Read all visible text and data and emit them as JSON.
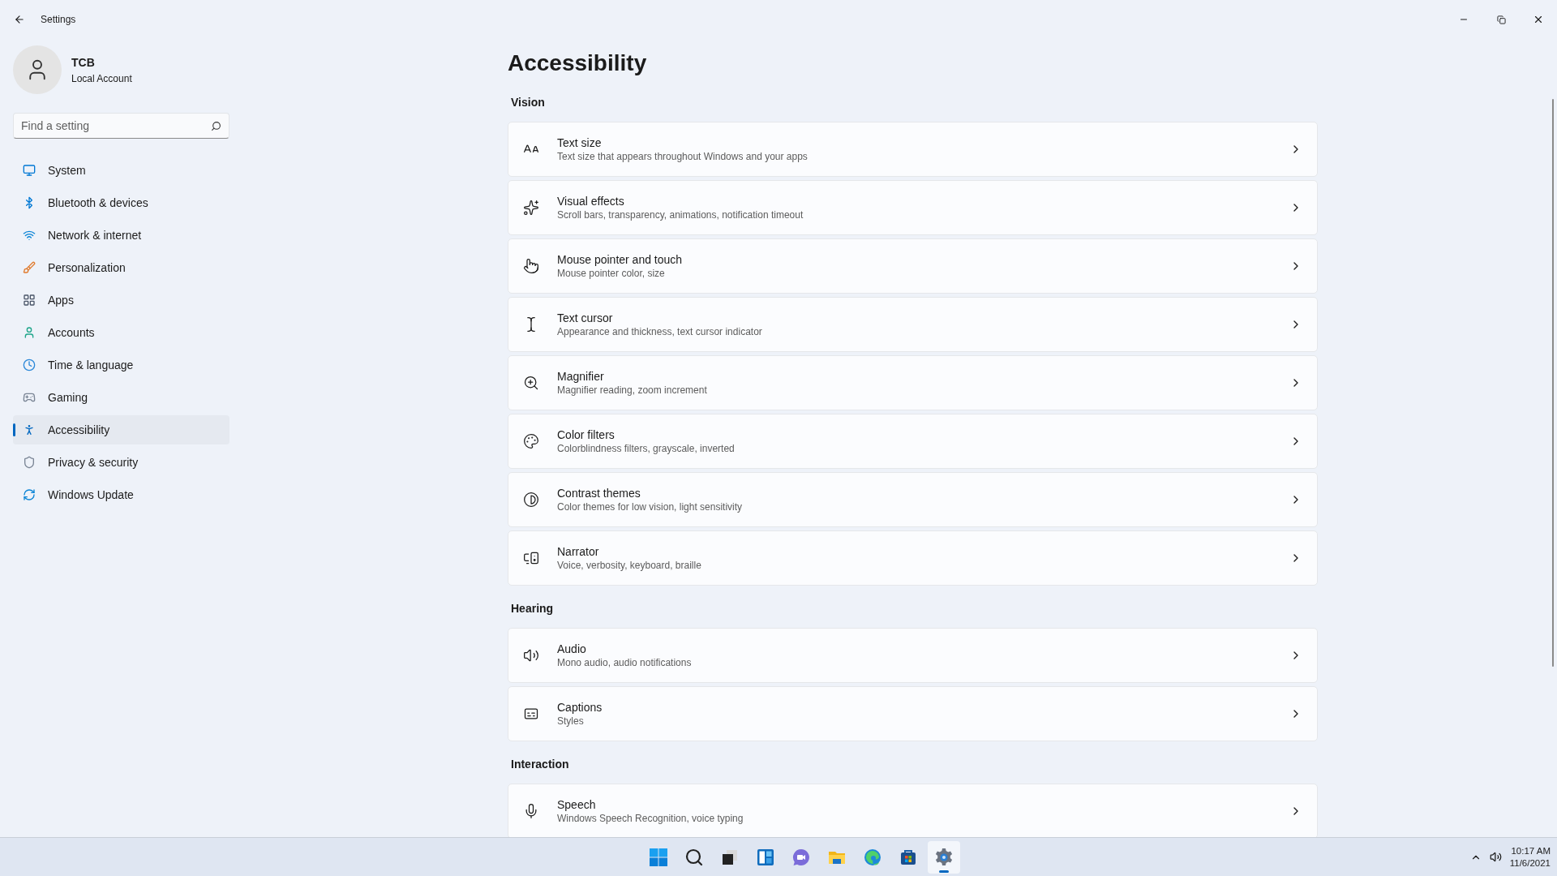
{
  "window": {
    "title": "Settings"
  },
  "account": {
    "name": "TCB",
    "type": "Local Account"
  },
  "search": {
    "placeholder": "Find a setting"
  },
  "nav": [
    {
      "label": "System",
      "selected": false
    },
    {
      "label": "Bluetooth & devices",
      "selected": false
    },
    {
      "label": "Network & internet",
      "selected": false
    },
    {
      "label": "Personalization",
      "selected": false
    },
    {
      "label": "Apps",
      "selected": false
    },
    {
      "label": "Accounts",
      "selected": false
    },
    {
      "label": "Time & language",
      "selected": false
    },
    {
      "label": "Gaming",
      "selected": false
    },
    {
      "label": "Accessibility",
      "selected": true
    },
    {
      "label": "Privacy & security",
      "selected": false
    },
    {
      "label": "Windows Update",
      "selected": false
    }
  ],
  "page_title": "Accessibility",
  "sections": [
    {
      "title": "Vision",
      "items": [
        {
          "title": "Text size",
          "subtitle": "Text size that appears throughout Windows and your apps"
        },
        {
          "title": "Visual effects",
          "subtitle": "Scroll bars, transparency, animations, notification timeout"
        },
        {
          "title": "Mouse pointer and touch",
          "subtitle": "Mouse pointer color, size"
        },
        {
          "title": "Text cursor",
          "subtitle": "Appearance and thickness, text cursor indicator"
        },
        {
          "title": "Magnifier",
          "subtitle": "Magnifier reading, zoom increment"
        },
        {
          "title": "Color filters",
          "subtitle": "Colorblindness filters, grayscale, inverted"
        },
        {
          "title": "Contrast themes",
          "subtitle": "Color themes for low vision, light sensitivity"
        },
        {
          "title": "Narrator",
          "subtitle": "Voice, verbosity, keyboard, braille"
        }
      ]
    },
    {
      "title": "Hearing",
      "items": [
        {
          "title": "Audio",
          "subtitle": "Mono audio, audio notifications"
        },
        {
          "title": "Captions",
          "subtitle": "Styles"
        }
      ]
    },
    {
      "title": "Interaction",
      "items": [
        {
          "title": "Speech",
          "subtitle": "Windows Speech Recognition, voice typing"
        }
      ]
    }
  ],
  "taskbar": {
    "apps": [
      {
        "selected": false
      },
      {
        "selected": false
      },
      {
        "selected": false
      },
      {
        "selected": false
      },
      {
        "selected": false
      },
      {
        "selected": false
      },
      {
        "selected": false
      },
      {
        "selected": false
      },
      {
        "selected": true
      }
    ]
  },
  "tray": {
    "time": "10:17 AM",
    "date": "11/6/2021"
  }
}
